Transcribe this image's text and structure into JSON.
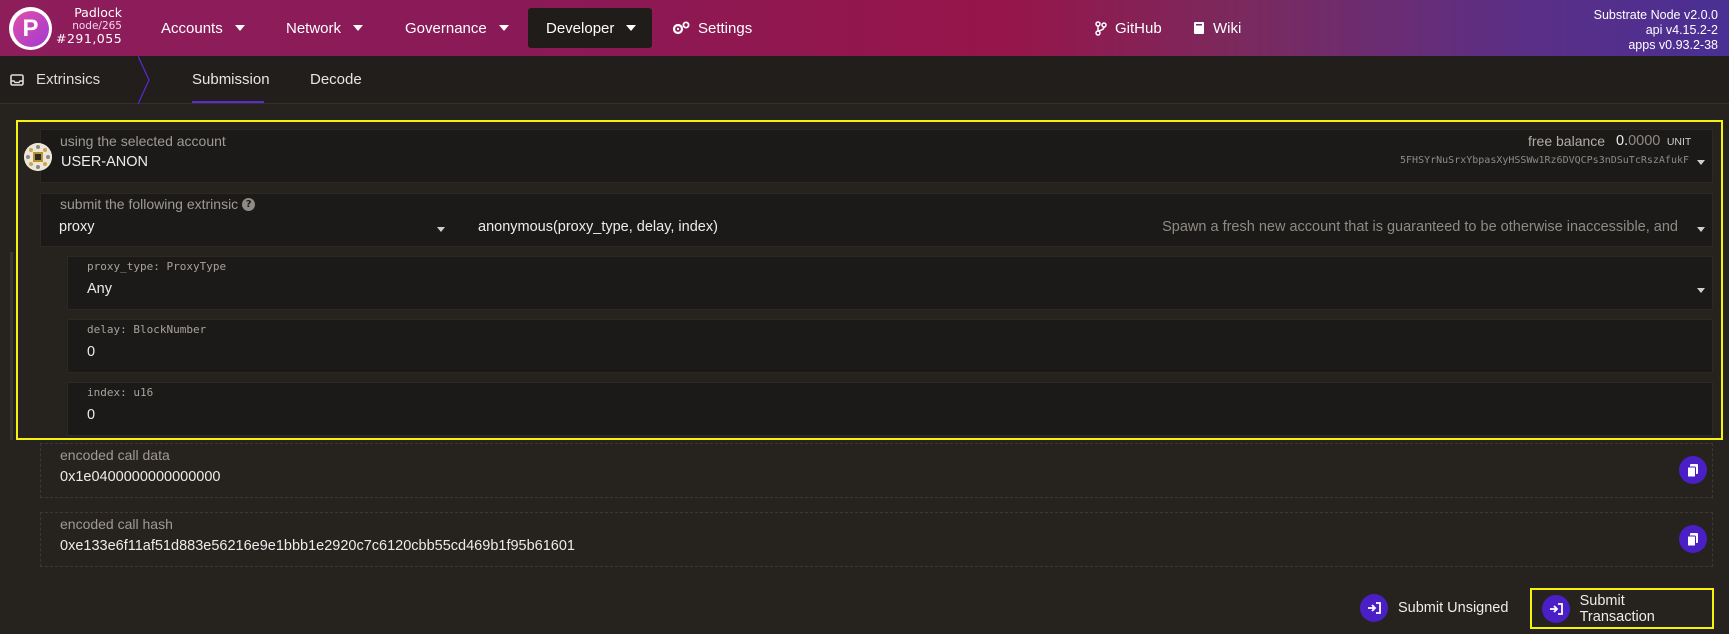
{
  "header": {
    "chain_name": "Padlock",
    "node": "node/265",
    "block": "#291,055",
    "nav": [
      {
        "label": "Accounts"
      },
      {
        "label": "Network"
      },
      {
        "label": "Governance"
      },
      {
        "label": "Developer"
      },
      {
        "label": "Settings"
      },
      {
        "label": "GitHub"
      },
      {
        "label": "Wiki"
      }
    ],
    "version": {
      "node": "Substrate Node v2.0.0",
      "api": "api v4.15.2-2",
      "apps": "apps v0.93.2-38"
    }
  },
  "subheader": {
    "section": "Extrinsics",
    "tabs": [
      {
        "label": "Submission",
        "active": true
      },
      {
        "label": "Decode",
        "active": false
      }
    ]
  },
  "account": {
    "label": "using the selected account",
    "name": "USER-ANON",
    "free_balance_label": "free balance",
    "balance_int": "0.",
    "balance_dec": "0000",
    "unit": "UNIT",
    "address": "5FHSYrNuSrxYbpasXyHSSWw1Rz6DVQCPs3nDSuTcRszAfukF"
  },
  "extrinsic": {
    "label": "submit the following extrinsic",
    "module": "proxy",
    "call": "anonymous(proxy_type, delay, index)",
    "description": "Spawn a fresh new account that is guaranteed to be otherwise inaccessible, and"
  },
  "params": [
    {
      "label": "proxy_type: ProxyType",
      "value": "Any"
    },
    {
      "label": "delay: BlockNumber",
      "value": "0"
    },
    {
      "label": "index: u16",
      "value": "0"
    }
  ],
  "encoded": {
    "data_label": "encoded call data",
    "data_value": "0x1e0400000000000000",
    "hash_label": "encoded call hash",
    "hash_value": "0xe133e6f11af51d883e56216e9e1bbb1e2920c7c6120cbb55cd469b1f95b61601"
  },
  "actions": {
    "unsigned": "Submit Unsigned",
    "transaction": "Submit Transaction"
  },
  "colors": {
    "accent": "#4a1fc6",
    "highlight": "#f5f20e"
  }
}
